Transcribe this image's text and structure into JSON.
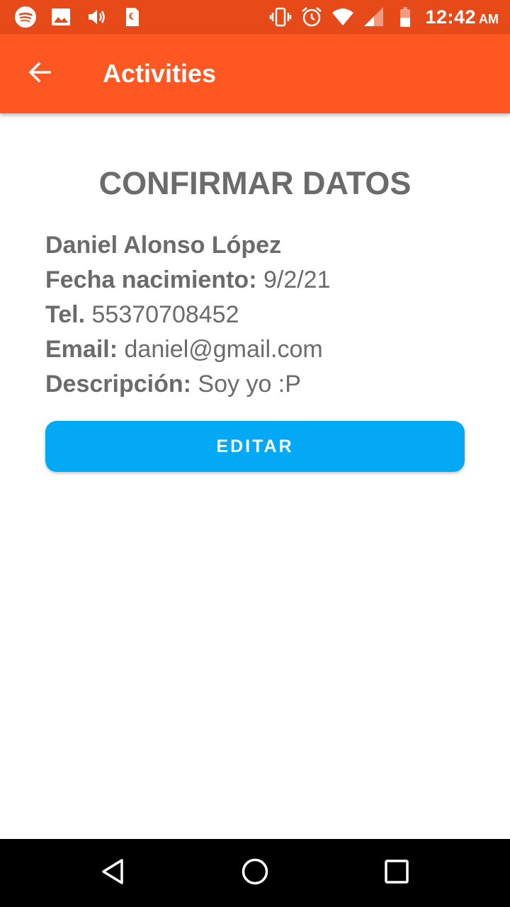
{
  "status_bar": {
    "time": "12:42",
    "ampm": "AM",
    "left_icons": [
      "spotify-icon",
      "image-icon",
      "volume-icon",
      "sim-icon"
    ],
    "right_icons": [
      "vibrate-icon",
      "alarm-icon",
      "wifi-icon",
      "signal-icon",
      "battery-icon"
    ]
  },
  "app_bar": {
    "title": "Activities",
    "back_icon": "arrow-left-icon",
    "color": "#ff5722"
  },
  "main": {
    "heading": "CONFIRMAR DATOS",
    "name": "Daniel Alonso López",
    "fields": {
      "birth_label": "Fecha nacimiento:",
      "birth_value": "9/2/21",
      "tel_label": "Tel.",
      "tel_value": "55370708452",
      "email_label": "Email:",
      "email_value": "daniel@gmail.com",
      "desc_label": "Descripción:",
      "desc_value": "Soy yo :P"
    },
    "edit_button": "EDITAR",
    "edit_button_color": "#03a9f4"
  },
  "nav_bar": {
    "icons": [
      "nav-back-icon",
      "nav-home-icon",
      "nav-recents-icon"
    ]
  }
}
